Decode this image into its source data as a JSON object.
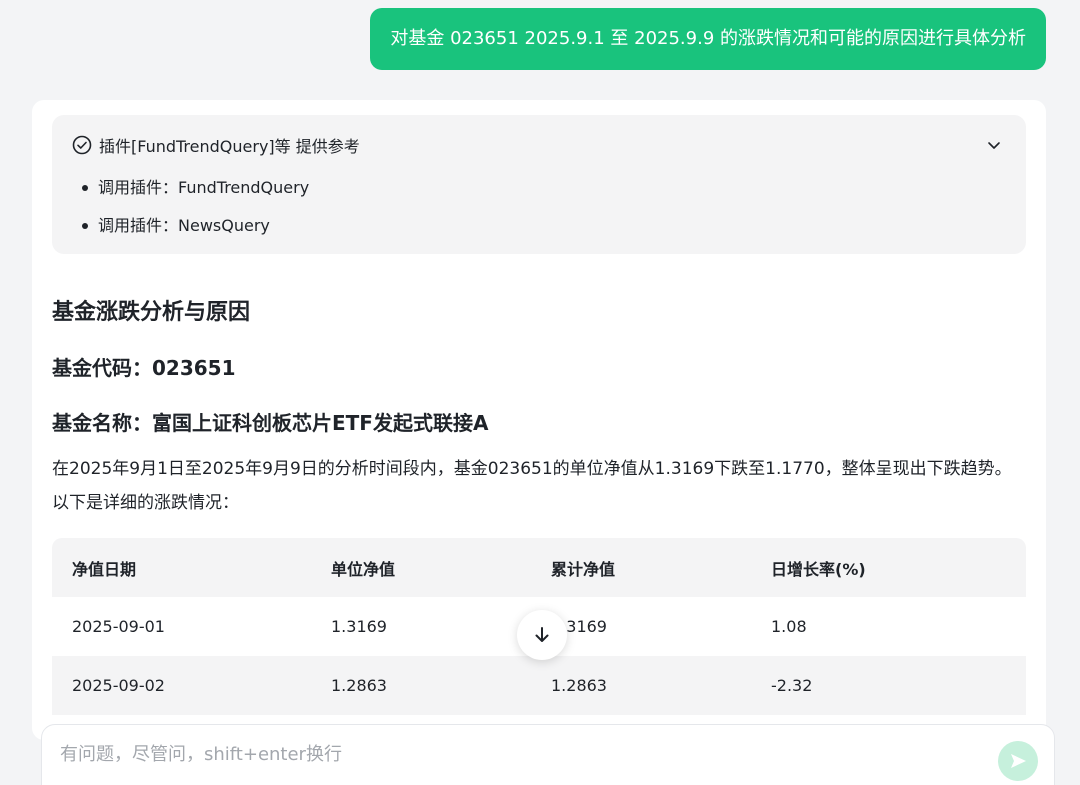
{
  "user_message": "对基金 023651 2025.9.1 至 2025.9.9 的涨跌情况和可能的原因进行具体分析",
  "plugins": {
    "title": "插件[FundTrendQuery]等 提供参考",
    "items": [
      "调用插件：FundTrendQuery",
      "调用插件：NewsQuery"
    ]
  },
  "answer": {
    "heading": "基金涨跌分析与原因",
    "fund_code": "基金代码：023651",
    "fund_name": "基金名称：富国上证科创板芯片ETF发起式联接A",
    "paragraph": "在2025年9月1日至2025年9月9日的分析时间段内，基金023651的单位净值从1.3169下跌至1.1770，整体呈现出下跌趋势。以下是详细的涨跌情况：",
    "table": {
      "headers": [
        "净值日期",
        "单位净值",
        "累计净值",
        "日增长率(%)"
      ],
      "rows": [
        [
          "2025-09-01",
          "1.3169",
          "1.3169",
          "1.08"
        ],
        [
          "2025-09-02",
          "1.2863",
          "1.2863",
          "-2.32"
        ]
      ]
    }
  },
  "input": {
    "placeholder": "有问题，尽管问，shift+enter换行"
  },
  "colors": {
    "accent": "#19c37d",
    "send_disabled": "#c6f0dc"
  },
  "icons": [
    "check-circle-icon",
    "chevron-down-icon",
    "arrow-down-icon",
    "send-icon"
  ]
}
